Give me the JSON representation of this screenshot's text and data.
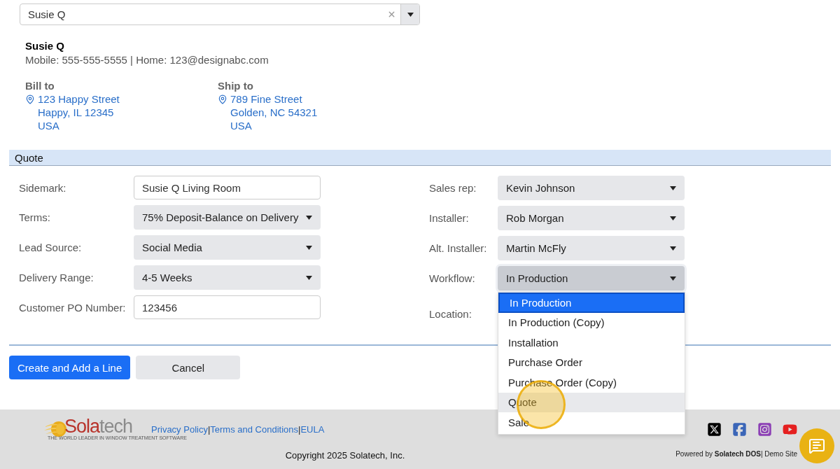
{
  "customer_select": {
    "value": "Susie Q"
  },
  "customer": {
    "name": "Susie Q",
    "contact": "Mobile: 555-555-5555 | Home: 123@designabc.com"
  },
  "addresses": [
    {
      "heading": "Bill to",
      "lines": [
        "123 Happy Street",
        "Happy, IL 12345",
        "USA"
      ]
    },
    {
      "heading": "Ship to",
      "lines": [
        "789 Fine Street",
        "Golden, NC 54321",
        "USA"
      ]
    }
  ],
  "section": {
    "title": "Quote"
  },
  "left_fields": [
    {
      "label": "Sidemark:",
      "kind": "text",
      "value": "Susie Q Living Room"
    },
    {
      "label": "Terms:",
      "kind": "select",
      "value": "75% Deposit-Balance on Delivery"
    },
    {
      "label": "Lead Source:",
      "kind": "select",
      "value": "Social Media"
    },
    {
      "label": "Delivery Range:",
      "kind": "select",
      "value": "4-5 Weeks"
    },
    {
      "label": "Customer PO Number:",
      "kind": "text",
      "value": "123456"
    }
  ],
  "right_fields": [
    {
      "label": "Sales rep:",
      "kind": "select",
      "value": "Kevin Johnson",
      "open": false
    },
    {
      "label": "Installer:",
      "kind": "select",
      "value": "Rob Morgan",
      "open": false
    },
    {
      "label": "Alt. Installer:",
      "kind": "select",
      "value": "Martin McFly",
      "open": false
    },
    {
      "label": "Workflow:",
      "kind": "select",
      "value": "In Production",
      "open": true
    },
    {
      "label": "Location:",
      "kind": "covered"
    }
  ],
  "workflow_menu": [
    {
      "label": "In Production",
      "selected": true,
      "hovered": false
    },
    {
      "label": "In Production (Copy)",
      "selected": false,
      "hovered": false
    },
    {
      "label": "Installation",
      "selected": false,
      "hovered": false
    },
    {
      "label": "Purchase Order",
      "selected": false,
      "hovered": false
    },
    {
      "label": "Purchase Order (Copy)",
      "selected": false,
      "hovered": false
    },
    {
      "label": "Quote",
      "selected": false,
      "hovered": true
    },
    {
      "label": "Sale",
      "selected": false,
      "hovered": false
    }
  ],
  "buttons": [
    {
      "label": "Create and Add a Line",
      "kind": "primary"
    },
    {
      "label": "Cancel",
      "kind": "secondary"
    }
  ],
  "footer": {
    "logo": {
      "part_1": "Sola",
      "part_2": "tech",
      "tagline": "THE WORLD LEADER IN WINDOW TREATMENT SOFTWARE"
    },
    "links": [
      "Privacy Policy",
      "Terms and Conditions",
      "EULA"
    ],
    "separator": "|",
    "copyright": "Copyright 2025 Solatech, Inc.",
    "powered": "Powered by **Solatech DOS**| Demo Site"
  }
}
